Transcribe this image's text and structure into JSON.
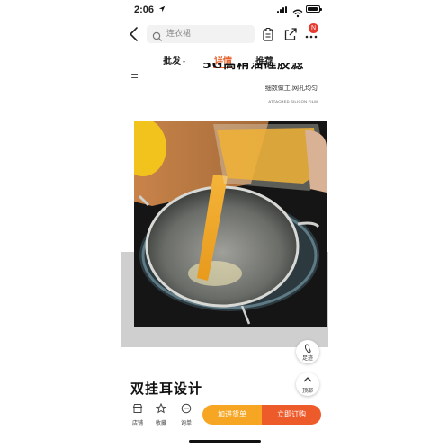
{
  "status_bar": {
    "time": "2:06",
    "location_icon": "location-arrow-icon",
    "signal_icon": "cellular-signal-icon",
    "wifi_icon": "wifi-icon",
    "battery_icon": "battery-icon"
  },
  "header": {
    "back_icon": "chevron-left-icon",
    "search": {
      "placeholder": "连衣裙",
      "icon": "search-icon"
    },
    "icons": [
      "clipboard-icon",
      "share-icon",
      "more-icon"
    ],
    "notification_badge": "N"
  },
  "tabs": [
    {
      "label": "批发",
      "caret": "▾"
    },
    {
      "label": "详情"
    },
    {
      "label": "推荐"
    }
  ],
  "active_tab": "详情",
  "content": {
    "menu_glyph": "≡",
    "banner_title": "5G高精油硅胶滤网",
    "subtitle": "细数做工,网孔均匀",
    "caption": "ATTACHED SILICON FILM",
    "photo": "orange-juice-poured-through-stainless-strainer"
  },
  "floating": {
    "footprint_label": "足迹",
    "top_label": "顶部"
  },
  "section_title": "双挂耳设计",
  "bottom_bar": {
    "store_label": "店铺",
    "favorite_label": "收藏",
    "inquiry_label": "询单",
    "add_cart_label": "加进货单",
    "buy_now_label": "立即订购"
  },
  "colors": {
    "accent": "#e8622c",
    "cart_button": "#f6a623",
    "buy_button": "#ee5b2b",
    "badge": "#e63a2e"
  }
}
